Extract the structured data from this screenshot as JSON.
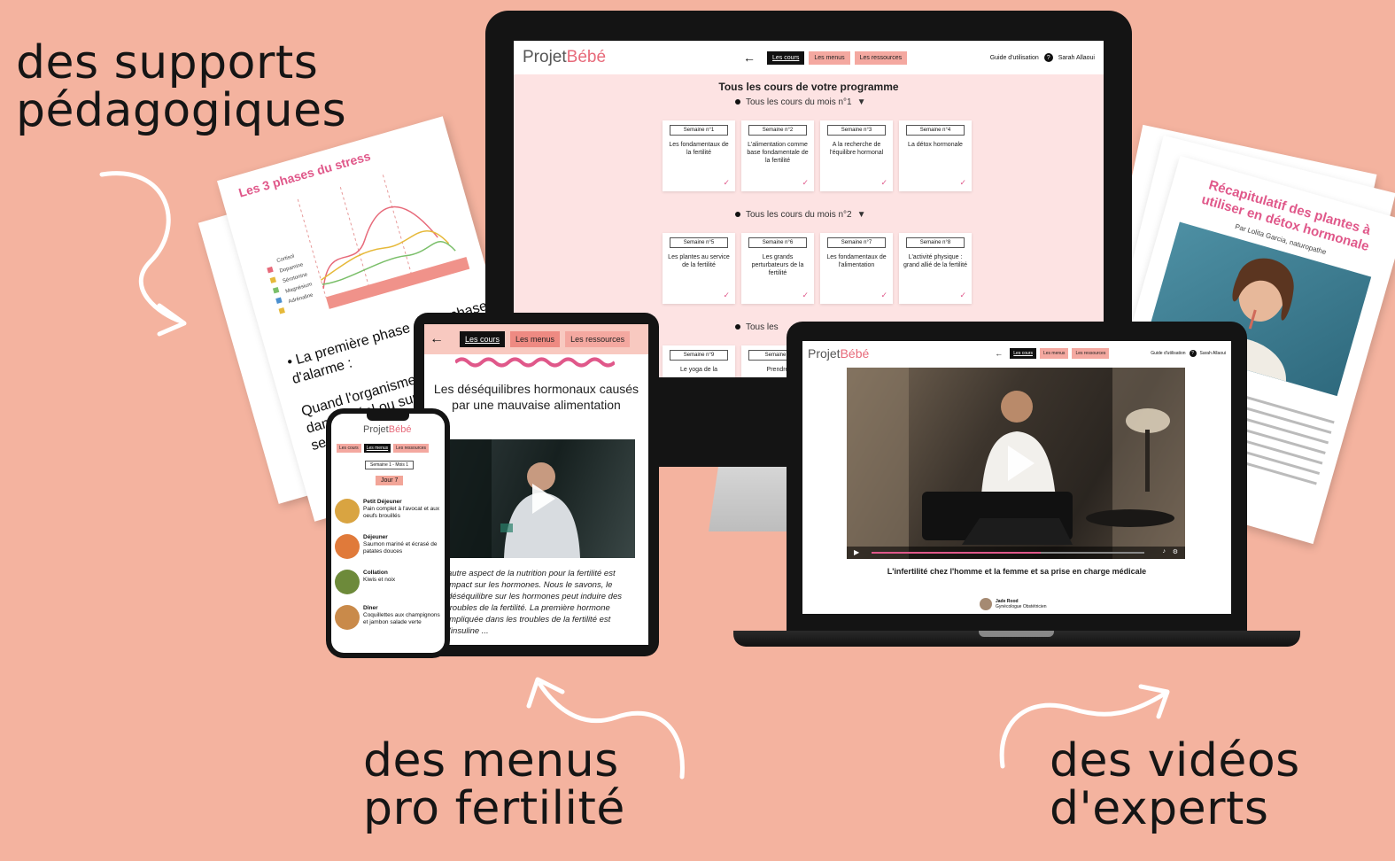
{
  "captions": {
    "supports": [
      "des supports",
      "pédagogiques"
    ],
    "menus": [
      "des menus",
      "pro fertilité"
    ],
    "videos": [
      "des vidéos",
      "d'experts"
    ]
  },
  "brand": {
    "logo_part1": "Projet",
    "logo_part2": "Bébé",
    "accent": "#e76a7a",
    "pink": "#f4a8a0"
  },
  "nav": {
    "cours": "Les cours",
    "menus": "Les menus",
    "ressources": "Les ressources"
  },
  "header_right": {
    "guide": "Guide d'utilisation",
    "user": "Sarah Allaoui"
  },
  "stress_sheet": {
    "title": "Les 3 phases du stress",
    "legend": [
      "Cortisol",
      "Dopamine",
      "Sérotonine",
      "Magnésium",
      "Adrénaline"
    ],
    "bullet": "• La première phase est la phase d'alarme :",
    "text": "Quand l'organisme perçoit un danger réel ou supposé, nos sens..."
  },
  "desktop": {
    "title": "Tous les cours de votre programme",
    "month1": "Tous les cours du mois n°1",
    "month2": "Tous les cours du mois n°2",
    "month3": "Tous les",
    "cards_month1": [
      {
        "week": "Semaine n°1",
        "name": "Les fondamentaux de la fertilité"
      },
      {
        "week": "Semaine n°2",
        "name": "L'alimentation comme base fondamentale de la fertilité"
      },
      {
        "week": "Semaine n°3",
        "name": "A la recherche de l'équilibre hormonal"
      },
      {
        "week": "Semaine n°4",
        "name": "La détox hormonale"
      }
    ],
    "cards_month2": [
      {
        "week": "Semaine n°5",
        "name": "Les plantes au service de la fertilité"
      },
      {
        "week": "Semaine n°6",
        "name": "Les grands perturbateurs de la fertilité"
      },
      {
        "week": "Semaine n°7",
        "name": "Les fondamentaux de l'alimentation"
      },
      {
        "week": "Semaine n°8",
        "name": "L'activité physique : grand allié de la fertilité"
      }
    ],
    "cards_month3": [
      {
        "week": "Semaine n°9",
        "name": "Le yoga de la"
      },
      {
        "week": "Semaine n",
        "name": "Prendre"
      }
    ]
  },
  "laptop": {
    "video_title": "L'infertilité chez l'homme et la femme et sa prise en charge médicale",
    "author_name": "Jade Rood",
    "author_role": "Gynécologue Obstétricien",
    "progress": 0.62
  },
  "tablet": {
    "title": "Les déséquilibres hormonaux causés par une mauvaise alimentation",
    "text": "autre aspect de la nutrition pour la fertilité est impact sur les hormones. Nous le savons, le déséquilibre sur les hormones peut induire des troubles de la fertilité. La première hormone impliquée dans les troubles de la fertilité est l'insuline ..."
  },
  "phone": {
    "week": "Semaine 1 - Mois 1",
    "day": "Jour 7",
    "meals": [
      {
        "name": "Petit Déjeuner",
        "desc": "Pain complet à l'avocat et aux oeufs brouillés",
        "color": "#d9a441"
      },
      {
        "name": "Déjeuner",
        "desc": "Saumon mariné et écrasé de patates douces",
        "color": "#e07a3a"
      },
      {
        "name": "Collation",
        "desc": "Kiwis et noix",
        "color": "#6d8a3a"
      },
      {
        "name": "Dîner",
        "desc": "Coquillettes aux champignons et jambon salade verte",
        "color": "#c98a4a"
      }
    ]
  },
  "recap_sheet": {
    "title": "Récapitulatif des plantes à utiliser en détox hormonale",
    "subtitle": "Par Lolita Garcia, naturopathe"
  }
}
